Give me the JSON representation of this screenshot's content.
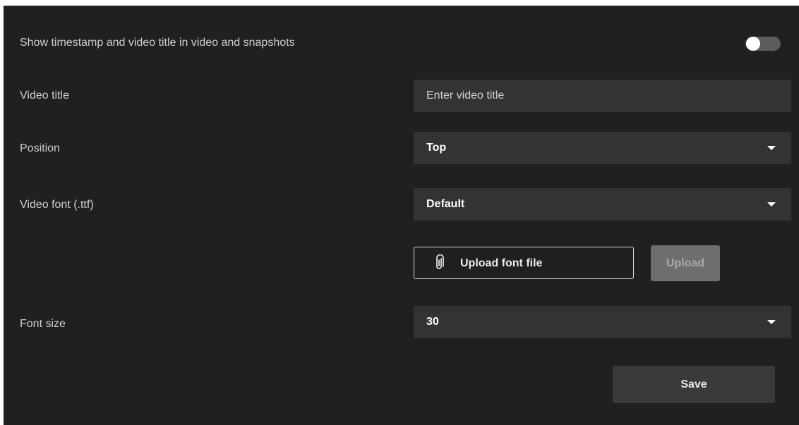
{
  "timestamp_setting": {
    "label": "Show timestamp and video title in video and snapshots",
    "enabled": false
  },
  "video_title": {
    "label": "Video title",
    "placeholder": "Enter video title",
    "value": ""
  },
  "position": {
    "label": "Position",
    "selected": "Top"
  },
  "video_font": {
    "label": "Video font (.ttf)",
    "selected": "Default"
  },
  "font_upload": {
    "file_label": "Upload font file",
    "upload_button": "Upload"
  },
  "font_size": {
    "label": "Font size",
    "selected": "30"
  },
  "save_button": "Save",
  "icons": {
    "file_picker": "paperclip-icon",
    "dropdown": "chevron-down-icon"
  },
  "colors": {
    "background": "#202020",
    "field": "#333333",
    "upload_disabled": "#6e6e6e",
    "save": "#3a3a3a",
    "toggle_track": "#5c5c5c"
  }
}
